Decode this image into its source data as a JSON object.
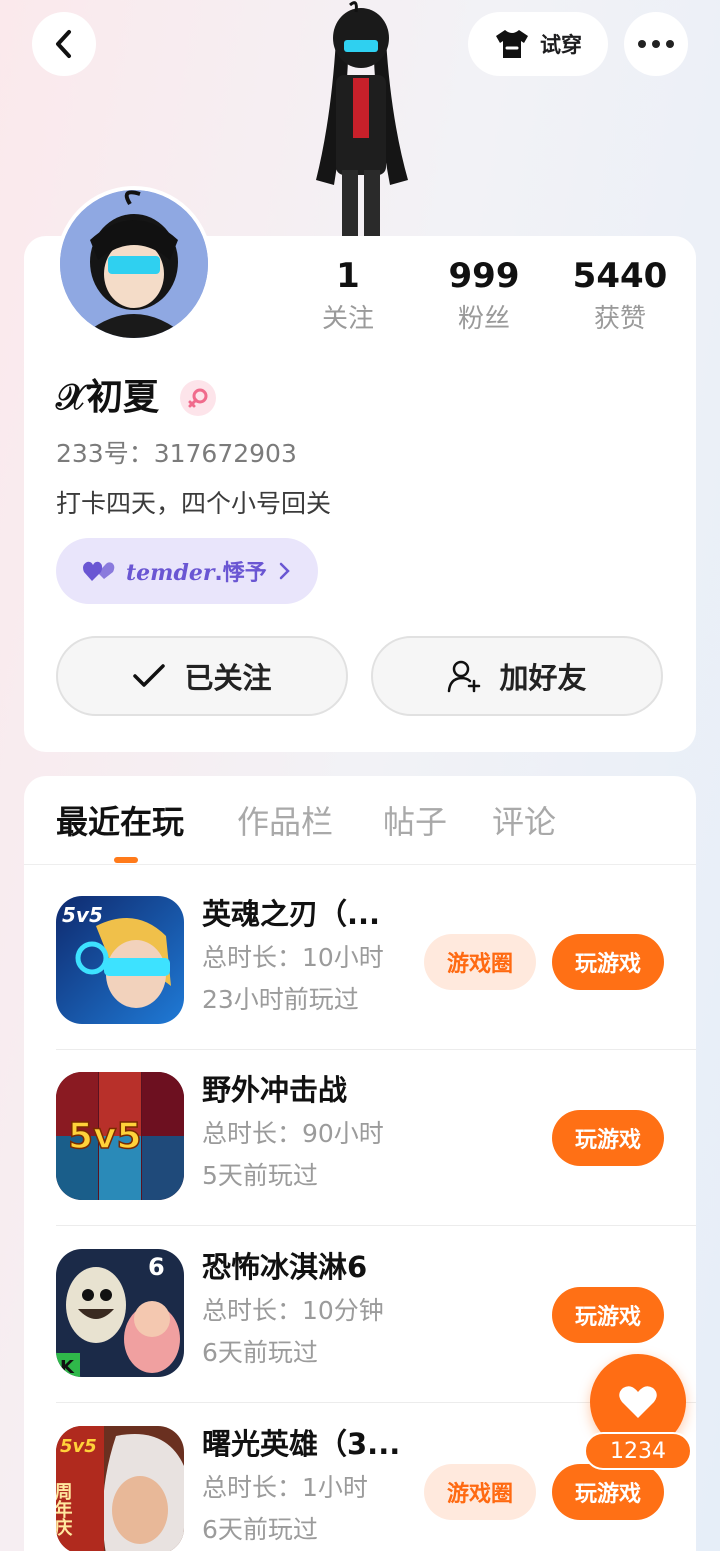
{
  "header": {
    "try_on_label": "试穿"
  },
  "profile": {
    "stats": [
      {
        "value": "1",
        "label": "关注"
      },
      {
        "value": "999",
        "label": "粉丝"
      },
      {
        "value": "5440",
        "label": "获赞"
      }
    ],
    "username": "𝒳初夏",
    "user_id": "233号：317672903",
    "bio": "打卡四天，四个小号回关",
    "relation_chip": {
      "name": "temder",
      "suffix": ".悸予"
    },
    "followed_label": "已关注",
    "add_friend_label": "加好友"
  },
  "tabs": [
    "最近在玩",
    "作品栏",
    "帖子",
    "评论"
  ],
  "games": [
    {
      "title": "英魂之刃（...",
      "duration": "总时长：10小时",
      "last_played": "23小时前玩过",
      "circle_label": "游戏圈",
      "play_label": "玩游戏"
    },
    {
      "title": "野外冲击战",
      "duration": "总时长：90小时",
      "last_played": "5天前玩过",
      "play_label": "玩游戏"
    },
    {
      "title": "恐怖冰淇淋6",
      "duration": "总时长：10分钟",
      "last_played": "6天前玩过",
      "play_label": "玩游戏"
    },
    {
      "title": "曙光英雄（3...",
      "duration": "总时长：1小时",
      "last_played": "6天前玩过",
      "circle_label": "游戏圈",
      "play_label": "玩游戏"
    }
  ],
  "game_icon_badges": {
    "game1": "5v5",
    "game2": "5v5",
    "game3_number": "6",
    "game3_corner": "K",
    "game4_top": "5v5",
    "game4_side": "周年庆"
  },
  "floating_like": {
    "count": "1234"
  },
  "colors": {
    "accent": "#ff7015",
    "accent_light": "#ffe9dd",
    "chip_bg": "#e9e5fb",
    "chip_text": "#6a56d3"
  }
}
